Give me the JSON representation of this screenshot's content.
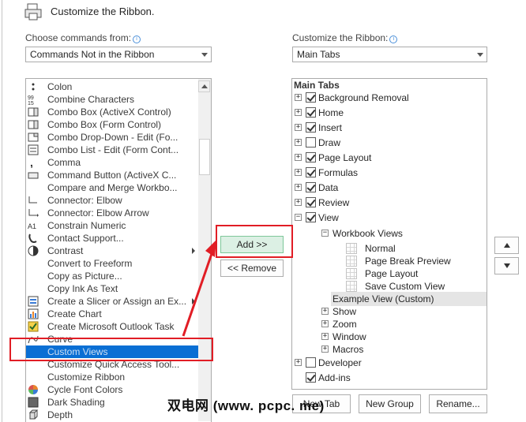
{
  "header": {
    "title": "Customize the Ribbon."
  },
  "left": {
    "label": "Choose commands from:",
    "combo_value": "Commands Not in the Ribbon",
    "commands": [
      {
        "label": "Colon",
        "icon": "colon-icon",
        "sub": false
      },
      {
        "label": "Combine Characters",
        "icon": "combine-characters-icon",
        "sub": false
      },
      {
        "label": "Combo Box (ActiveX Control)",
        "icon": "combo-box-icon",
        "sub": false
      },
      {
        "label": "Combo Box (Form Control)",
        "icon": "combo-box-icon",
        "sub": false
      },
      {
        "label": "Combo Drop-Down - Edit (Fo...",
        "icon": "combo-dropdown-icon",
        "sub": false
      },
      {
        "label": "Combo List - Edit (Form Cont...",
        "icon": "combo-list-icon",
        "sub": false
      },
      {
        "label": "Comma",
        "icon": "comma-icon",
        "sub": false
      },
      {
        "label": "Command Button (ActiveX C...",
        "icon": "command-button-icon",
        "sub": false
      },
      {
        "label": "Compare and Merge Workbo...",
        "icon": "compare-icon",
        "sub": false
      },
      {
        "label": "Connector: Elbow",
        "icon": "connector-elbow-icon",
        "sub": false
      },
      {
        "label": "Connector: Elbow Arrow",
        "icon": "connector-elbow-arrow-icon",
        "sub": false
      },
      {
        "label": "Constrain Numeric",
        "icon": "constrain-numeric-icon",
        "sub": false
      },
      {
        "label": "Contact Support...",
        "icon": "contact-support-icon",
        "sub": false
      },
      {
        "label": "Contrast",
        "icon": "contrast-icon",
        "sub": true
      },
      {
        "label": "Convert to Freeform",
        "icon": "",
        "sub": false
      },
      {
        "label": "Copy as Picture...",
        "icon": "",
        "sub": false
      },
      {
        "label": "Copy Ink As Text",
        "icon": "",
        "sub": false
      },
      {
        "label": "Create a Slicer or Assign an Ex...",
        "icon": "slicer-icon",
        "sub": true
      },
      {
        "label": "Create Chart",
        "icon": "chart-icon",
        "sub": false
      },
      {
        "label": "Create Microsoft Outlook Task",
        "icon": "outlook-task-icon",
        "sub": false
      },
      {
        "label": "Curve",
        "icon": "curve-icon",
        "sub": false
      },
      {
        "label": "Custom Views",
        "icon": "",
        "sub": false,
        "selected": true
      },
      {
        "label": "Customize Quick Access Tool...",
        "icon": "",
        "sub": false
      },
      {
        "label": "Customize Ribbon",
        "icon": "",
        "sub": false
      },
      {
        "label": "Cycle Font Colors",
        "icon": "cycle-font-colors-icon",
        "sub": false
      },
      {
        "label": "Dark Shading",
        "icon": "dark-shading-icon",
        "sub": false
      },
      {
        "label": "Depth",
        "icon": "depth-icon",
        "sub": false
      }
    ]
  },
  "middle": {
    "add_label": "Add >>",
    "remove_label": "<< Remove"
  },
  "right": {
    "label": "Customize the Ribbon:",
    "combo_value": "Main Tabs",
    "tree_header": "Main Tabs",
    "tabs": [
      {
        "label": "Background Removal",
        "checked": true,
        "exp": "+"
      },
      {
        "label": "Home",
        "checked": true,
        "exp": "+"
      },
      {
        "label": "Insert",
        "checked": true,
        "exp": "+"
      },
      {
        "label": "Draw",
        "checked": false,
        "exp": "+"
      },
      {
        "label": "Page Layout",
        "checked": true,
        "exp": "+"
      },
      {
        "label": "Formulas",
        "checked": true,
        "exp": "+"
      },
      {
        "label": "Data",
        "checked": true,
        "exp": "+"
      },
      {
        "label": "Review",
        "checked": true,
        "exp": "+"
      },
      {
        "label": "View",
        "checked": true,
        "exp": "−"
      }
    ],
    "workbook_views": "Workbook Views",
    "view_items": [
      "Normal",
      "Page Break Preview",
      "Page Layout",
      "Save Custom View"
    ],
    "example_view": "Example View  (Custom)",
    "view_groups": [
      "Show",
      "Zoom",
      "Window",
      "Macros"
    ],
    "bottom_tabs": [
      {
        "label": "Developer",
        "checked": false,
        "exp": "+"
      },
      {
        "label": "Add-ins",
        "checked": true,
        "exp": ""
      }
    ],
    "buttons": {
      "new_tab": "New Tab",
      "new_group": "New Group",
      "rename": "Rename..."
    }
  },
  "watermark": "双电网 (www. pcpc. me)"
}
